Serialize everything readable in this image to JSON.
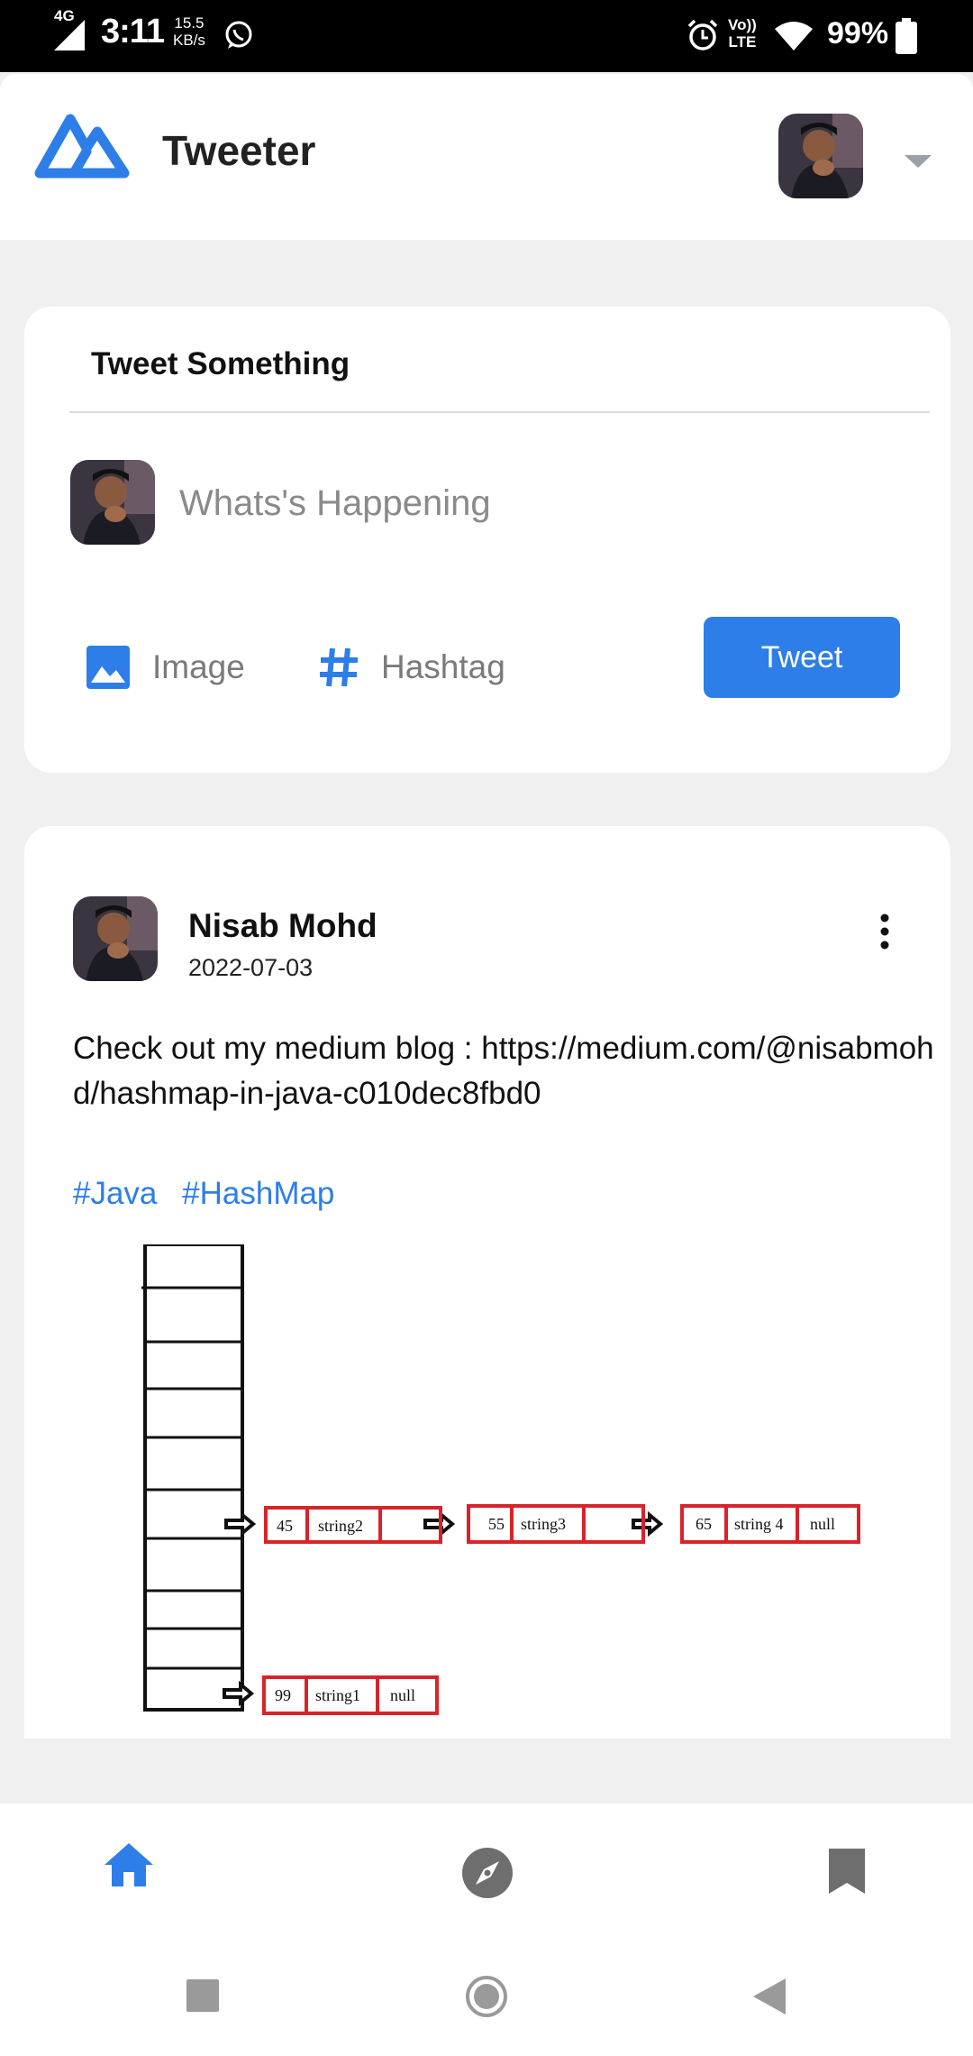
{
  "status_bar": {
    "network": "4G",
    "time": "3:11",
    "speed_value": "15.5",
    "speed_unit": "KB/s",
    "volte_top": "Vo))",
    "volte_bottom": "LTE",
    "battery": "99%",
    "icons": [
      "signal-icon",
      "whatsapp-icon",
      "alarm-icon",
      "wifi-icon",
      "battery-icon"
    ]
  },
  "header": {
    "title": "Tweeter",
    "logo": "tweeter-logo-icon",
    "accent": "#2d7ee8"
  },
  "compose": {
    "title": "Tweet Something",
    "placeholder": "Whats's Happening",
    "image_label": "Image",
    "hashtag_label": "Hashtag",
    "tweet_button": "Tweet"
  },
  "post": {
    "author": "Nisab Mohd",
    "date": "2022-07-03",
    "text": "Check out my medium blog : https://medium.com/@nisabmohd/hashmap-in-java-c010dec8fbd0",
    "tags": [
      "#Java",
      "#HashMap"
    ],
    "image": {
      "row1": [
        "45",
        "string2",
        ""
      ],
      "row2": [
        "55",
        "string3",
        ""
      ],
      "row3": [
        "65",
        "string 4",
        "null"
      ],
      "row4": [
        "99",
        "string1",
        "null"
      ]
    }
  },
  "bottom_nav": {
    "items": [
      "home-icon",
      "explore-icon",
      "bookmark-icon"
    ],
    "active": "home-icon"
  },
  "system_nav": [
    "recents-icon",
    "home-button-icon",
    "back-icon"
  ]
}
